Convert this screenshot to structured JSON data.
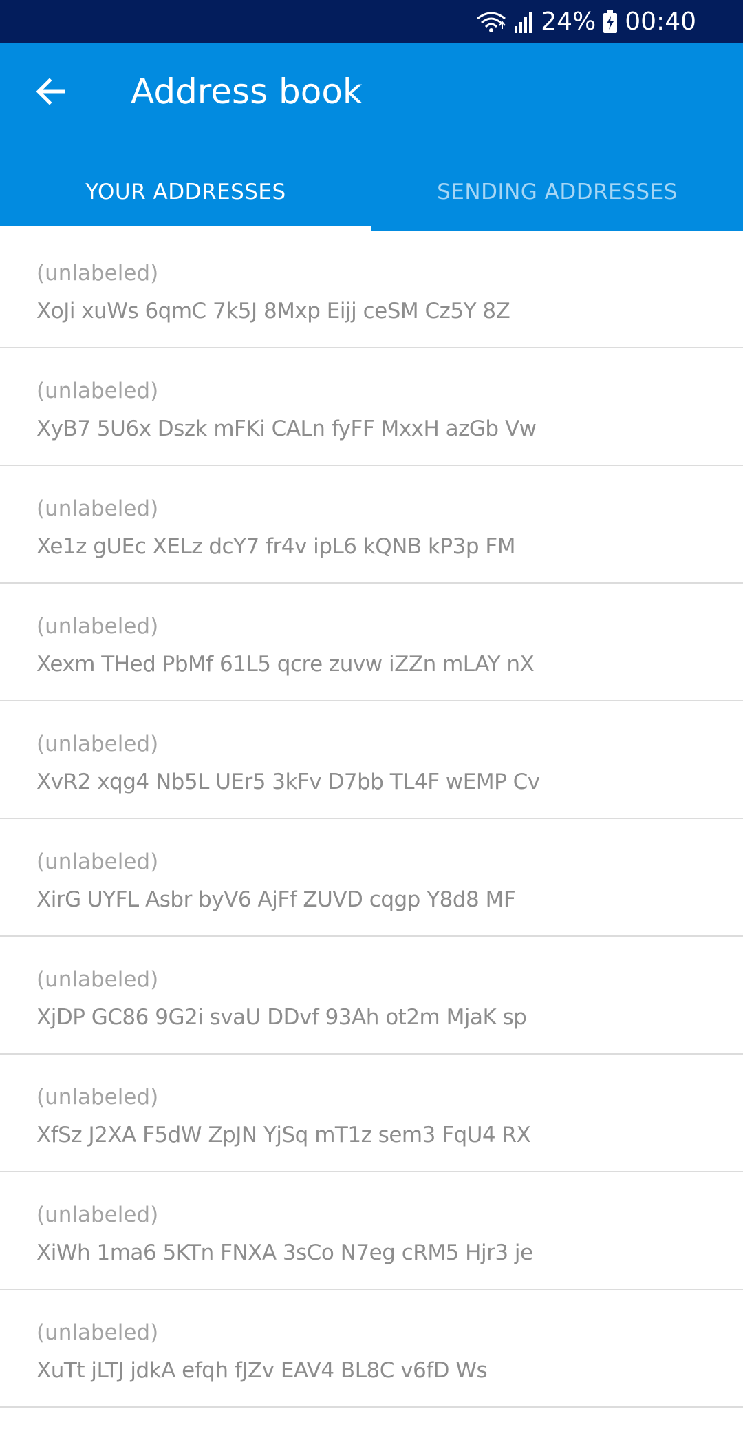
{
  "status_bar": {
    "battery": "24%",
    "time": "00:40",
    "icons": [
      "wifi-icon",
      "signal-icon",
      "battery-charging-icon"
    ]
  },
  "app_bar": {
    "back_icon": "arrow-left-icon",
    "title": "Address book"
  },
  "tabs": [
    {
      "label": "YOUR ADDRESSES",
      "active": true
    },
    {
      "label": "SENDING ADDRESSES",
      "active": false
    }
  ],
  "addresses": [
    {
      "label": "(unlabeled)",
      "address": "XoJi xuWs 6qmC 7k5J 8Mxp Eijj ceSM Cz5Y 8Z"
    },
    {
      "label": "(unlabeled)",
      "address": "XyB7 5U6x Dszk mFKi CALn fyFF MxxH azGb Vw"
    },
    {
      "label": "(unlabeled)",
      "address": "Xe1z gUEc XELz dcY7 fr4v ipL6 kQNB kP3p FM"
    },
    {
      "label": "(unlabeled)",
      "address": "Xexm THed PbMf 61L5 qcre zuvw iZZn mLAY nX"
    },
    {
      "label": "(unlabeled)",
      "address": "XvR2 xqg4 Nb5L UEr5 3kFv D7bb TL4F wEMP Cv"
    },
    {
      "label": "(unlabeled)",
      "address": "XirG UYFL Asbr byV6 AjFf ZUVD cqgp Y8d8 MF"
    },
    {
      "label": "(unlabeled)",
      "address": "XjDP GC86 9G2i svaU DDvf 93Ah ot2m MjaK sp"
    },
    {
      "label": "(unlabeled)",
      "address": "XfSz J2XA F5dW ZpJN YjSq mT1z sem3 FqU4 RX"
    },
    {
      "label": "(unlabeled)",
      "address": "XiWh 1ma6 5KTn FNXA 3sCo N7eg cRM5 Hjr3 je"
    },
    {
      "label": "(unlabeled)",
      "address": "XuTt jLTJ jdkA efqh fJZv EAV4 BL8C v6fD Ws"
    }
  ],
  "colors": {
    "status_bar": "#031d5c",
    "app_bar": "#028be0",
    "inactive_tab": "#a6d6f5",
    "divider": "#dcdcdc",
    "label_text": "#a4a4a4",
    "address_text": "#8d8d8d"
  }
}
